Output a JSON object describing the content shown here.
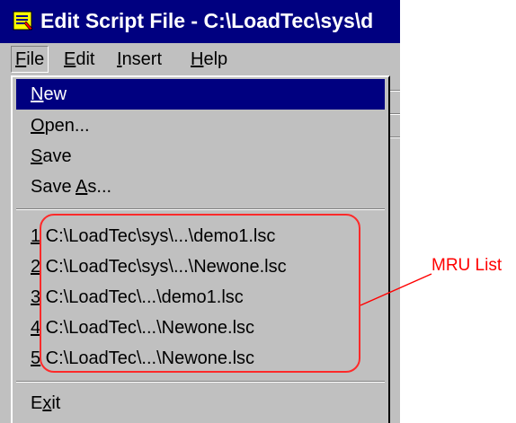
{
  "window": {
    "title": "Edit Script File - C:\\LoadTec\\sys\\d",
    "icon": "script-file-icon"
  },
  "menubar": {
    "items": [
      {
        "mnemonic": "F",
        "rest": "ile"
      },
      {
        "mnemonic": "E",
        "rest": "dit"
      },
      {
        "mnemonic": "I",
        "rest": "nsert"
      },
      {
        "mnemonic": "H",
        "rest": "elp"
      }
    ]
  },
  "file_menu": {
    "new": {
      "mnemonic": "N",
      "rest": "ew"
    },
    "open": {
      "mnemonic": "O",
      "rest": "pen..."
    },
    "save": {
      "mnemonic": "S",
      "rest": "ave"
    },
    "save_as": {
      "before": "Save ",
      "mnemonic": "A",
      "rest": "s..."
    },
    "mru": [
      {
        "num": "1",
        "path": " C:\\LoadTec\\sys\\...\\demo1.lsc"
      },
      {
        "num": "2",
        "path": " C:\\LoadTec\\sys\\...\\Newone.lsc"
      },
      {
        "num": "3",
        "path": " C:\\LoadTec\\...\\demo1.lsc"
      },
      {
        "num": "4",
        "path": " C:\\LoadTec\\...\\Newone.lsc"
      },
      {
        "num": "5",
        "path": " C:\\LoadTec\\...\\Newone.lsc"
      }
    ],
    "exit": {
      "before": "E",
      "mnemonic": "x",
      "rest": "it"
    }
  },
  "annotation": {
    "label": "MRU List",
    "color": "#ff0000"
  },
  "colors": {
    "titlebar": "#000080",
    "menu_face": "#c0c0c0",
    "highlight": "#000080"
  }
}
